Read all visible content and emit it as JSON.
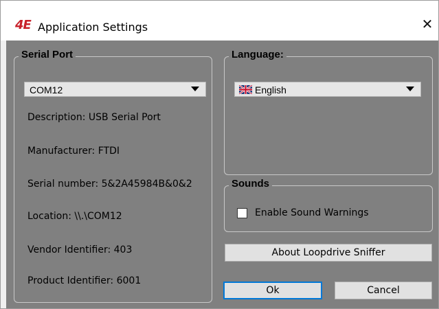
{
  "window": {
    "logo_text": "4E",
    "title": "Application Settings",
    "close_glyph": "✕"
  },
  "serial_port": {
    "group_label": "Serial Port",
    "selected_port": "COM12",
    "description": "Description: USB Serial Port",
    "manufacturer": "Manufacturer: FTDI",
    "serial_number": "Serial number: 5&2A45984B&0&2",
    "location": "Location: \\\\.\\COM12",
    "vendor_id": "Vendor Identifier: 403",
    "product_id": "Product Identifier: 6001"
  },
  "language": {
    "group_label": "Language:",
    "selected": "English",
    "flag_icon": "uk-flag-icon"
  },
  "sounds": {
    "group_label": "Sounds",
    "enable_warnings_label": "Enable Sound Warnings",
    "enable_warnings_checked": false
  },
  "buttons": {
    "about": "About Loopdrive Sniffer",
    "ok": "Ok",
    "cancel": "Cancel"
  },
  "colors": {
    "client_bg": "#808080",
    "default_button_border": "#0078d7",
    "logo": "#c8202a"
  }
}
